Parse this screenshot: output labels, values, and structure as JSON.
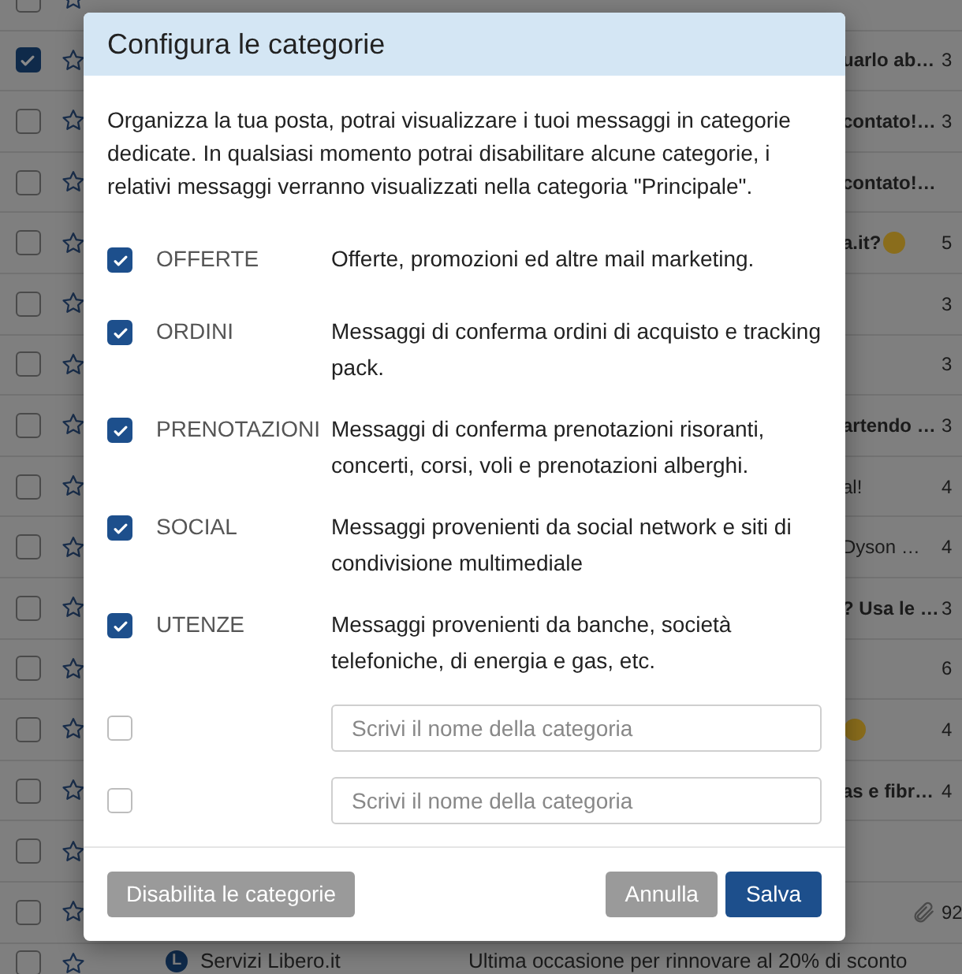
{
  "mail_list": {
    "rows": [
      {
        "checked": false
      },
      {
        "checked": true,
        "subject": "uarlo ab…",
        "date": "3"
      },
      {
        "checked": false,
        "subject": "contato!…",
        "date": "3"
      },
      {
        "checked": false,
        "subject": "contato!…"
      },
      {
        "checked": false,
        "subject": "a.it?",
        "emoji": true,
        "date": "5"
      },
      {
        "checked": false,
        "date": "3"
      },
      {
        "checked": false,
        "date": "3"
      },
      {
        "checked": false,
        "subject": "artendo …",
        "date": "3"
      },
      {
        "checked": false,
        "subject": "al!",
        "bold": false,
        "date": "4"
      },
      {
        "checked": false,
        "subject": "Dyson …",
        "bold": false,
        "date": "4"
      },
      {
        "checked": false,
        "subject": "? Usa le …",
        "date": "3"
      },
      {
        "checked": false,
        "date": "6"
      },
      {
        "checked": false,
        "emoji": true,
        "date": "4"
      },
      {
        "checked": false,
        "subject": "as e fibr…",
        "date": "4"
      },
      {
        "checked": false
      },
      {
        "checked": false,
        "attachment": true,
        "date": "92"
      },
      {
        "checked": false,
        "avatar": "L",
        "sender": "Servizi Libero.it",
        "preview": "Ultima occasione per rinnovare al 20% di sconto"
      }
    ]
  },
  "dialog": {
    "title": "Configura le categorie",
    "intro": "Organizza la tua posta, potrai visualizzare i tuoi messaggi in categorie dedicate. In qualsiasi momento potrai disabilitare alcune categorie, i relativi messaggi verranno visualizzati nella categoria \"Principale\".",
    "categories": [
      {
        "kind": "preset",
        "checked": true,
        "name": "OFFERTE",
        "description": "Offerte, promozioni ed altre mail marketing."
      },
      {
        "kind": "preset",
        "checked": true,
        "name": "ORDINI",
        "description": "Messaggi di conferma ordini di acquisto e tracking pack."
      },
      {
        "kind": "preset",
        "checked": true,
        "name": "PRENOTAZIONI",
        "description": "Messaggi di conferma prenotazioni risoranti, concerti, corsi, voli e prenotazioni alberghi."
      },
      {
        "kind": "preset",
        "checked": true,
        "name": "SOCIAL",
        "description": "Messaggi provenienti da social network e siti di condivisione multimediale"
      },
      {
        "kind": "preset",
        "checked": true,
        "name": "UTENZE",
        "description": "Messaggi provenienti da banche, società telefoniche, di energia e gas, etc."
      },
      {
        "kind": "custom",
        "checked": false,
        "placeholder": "Scrivi il nome della categoria"
      },
      {
        "kind": "custom",
        "checked": false,
        "placeholder": "Scrivi il nome della categoria"
      }
    ],
    "buttons": {
      "disable": "Disabilita le categorie",
      "cancel": "Annulla",
      "save": "Salva"
    }
  }
}
